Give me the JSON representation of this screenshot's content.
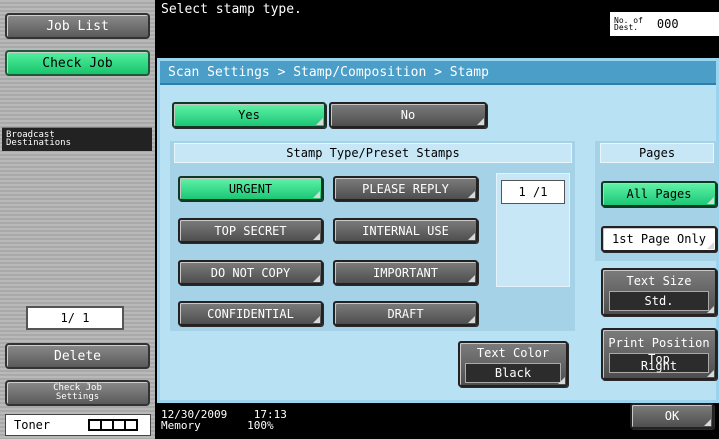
{
  "left_panel": {
    "job_list": "Job List",
    "check_job": "Check Job",
    "broadcast": "Broadcast\nDestinations",
    "page_counter": "1/  1",
    "delete": "Delete",
    "check_job_settings": "Check Job\nSettings",
    "toner_label": "Toner",
    "toner_level_segments": 4
  },
  "header": {
    "message": "Select stamp type.",
    "dest_label": "No. of\nDest.",
    "dest_count": "000"
  },
  "breadcrumb": "Scan Settings > Stamp/Composition > Stamp",
  "toggle": {
    "yes": "Yes",
    "no": "No",
    "selected": "Yes"
  },
  "stamps": {
    "header": "Stamp Type/Preset Stamps",
    "counter": "1  /1",
    "items": [
      "URGENT",
      "PLEASE REPLY",
      "TOP SECRET",
      "INTERNAL USE",
      "DO NOT COPY",
      "IMPORTANT",
      "CONFIDENTIAL",
      "DRAFT"
    ],
    "selected": "URGENT"
  },
  "pages": {
    "header": "Pages",
    "all_pages": "All Pages",
    "first_page_only": "1st Page Only",
    "selected": "All Pages"
  },
  "text_size": {
    "label": "Text Size",
    "value": "Std."
  },
  "print_position": {
    "label": "Print Position",
    "value": "Top\nRight"
  },
  "text_color": {
    "label": "Text Color",
    "value": "Black"
  },
  "ok": "OK",
  "footer": {
    "date": "12/30/2009",
    "time": "17:13",
    "memory_label": "Memory",
    "memory_value": "100%"
  },
  "colors": {
    "selected_green": "#1ac775",
    "panel_blue": "#b8e1f4",
    "header_blue": "#4a9ec8"
  }
}
